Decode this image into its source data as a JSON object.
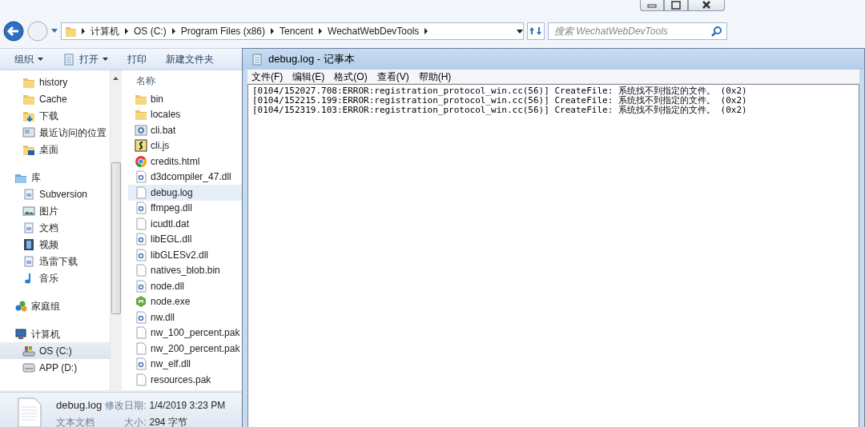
{
  "explorer": {
    "window_controls": [
      {
        "kind": "minimize"
      },
      {
        "kind": "maximize"
      },
      {
        "kind": "close"
      }
    ],
    "breadcrumb": [
      "计算机",
      "OS (C:)",
      "Program Files (x86)",
      "Tencent",
      "WechatWebDevTools"
    ],
    "search": {
      "placeholder": "搜索 WechatWebDevTools"
    },
    "toolbar": [
      {
        "label": "组织",
        "dropdown": true,
        "kind": "plain"
      },
      {
        "label": "打开",
        "dropdown": true,
        "kind": "notepad"
      },
      {
        "label": "打印",
        "dropdown": false,
        "kind": "plain"
      },
      {
        "label": "新建文件夹",
        "dropdown": false,
        "kind": "plain"
      }
    ],
    "nav_groups": [
      {
        "items": [
          {
            "label": "history",
            "kind": "folder",
            "selected": false
          },
          {
            "label": "Cache",
            "kind": "folder",
            "selected": false
          },
          {
            "label": "下载",
            "kind": "download",
            "selected": false
          },
          {
            "label": "最近访问的位置",
            "kind": "recent",
            "selected": false
          },
          {
            "label": "桌面",
            "kind": "desktop",
            "selected": false
          }
        ]
      },
      {
        "label": "库",
        "kind": "library",
        "items": [
          {
            "label": "Subversion",
            "kind": "doc",
            "selected": false
          },
          {
            "label": "图片",
            "kind": "picture",
            "selected": false
          },
          {
            "label": "文档",
            "kind": "doc",
            "selected": false
          },
          {
            "label": "视频",
            "kind": "video",
            "selected": false
          },
          {
            "label": "迅雷下载",
            "kind": "doc",
            "selected": false
          },
          {
            "label": "音乐",
            "kind": "music",
            "selected": false
          }
        ]
      },
      {
        "label": "家庭组",
        "kind": "homegroup"
      },
      {
        "label": "计算机",
        "kind": "computer",
        "items": [
          {
            "label": "OS (C:)",
            "kind": "osdrive",
            "selected": true
          },
          {
            "label": "APP (D:)",
            "kind": "drive",
            "selected": false
          }
        ]
      }
    ],
    "column_header": "名称",
    "files": [
      {
        "name": "bin",
        "kind": "folder",
        "selected": false
      },
      {
        "name": "locales",
        "kind": "folder",
        "selected": false
      },
      {
        "name": "cli.bat",
        "kind": "bat",
        "selected": false
      },
      {
        "name": "cli.js",
        "kind": "js",
        "selected": false
      },
      {
        "name": "credits.html",
        "kind": "chrome",
        "selected": false
      },
      {
        "name": "d3dcompiler_47.dll",
        "kind": "dll",
        "selected": false
      },
      {
        "name": "debug.log",
        "kind": "file",
        "selected": true
      },
      {
        "name": "ffmpeg.dll",
        "kind": "dll",
        "selected": false
      },
      {
        "name": "icudtl.dat",
        "kind": "file",
        "selected": false
      },
      {
        "name": "libEGL.dll",
        "kind": "dll",
        "selected": false
      },
      {
        "name": "libGLESv2.dll",
        "kind": "dll",
        "selected": false
      },
      {
        "name": "natives_blob.bin",
        "kind": "file",
        "selected": false
      },
      {
        "name": "node.dll",
        "kind": "dll",
        "selected": false
      },
      {
        "name": "node.exe",
        "kind": "node",
        "selected": false
      },
      {
        "name": "nw.dll",
        "kind": "dll",
        "selected": false
      },
      {
        "name": "nw_100_percent.pak",
        "kind": "file",
        "selected": false
      },
      {
        "name": "nw_200_percent.pak",
        "kind": "file",
        "selected": false
      },
      {
        "name": "nw_elf.dll",
        "kind": "dll",
        "selected": false
      },
      {
        "name": "resources.pak",
        "kind": "file",
        "selected": false
      }
    ],
    "status": {
      "name": "debug.log",
      "type": "文本文档",
      "modified_label": "修改日期:",
      "modified": "1/4/2019 3:23 PM",
      "size_label": "大小:",
      "size": "294 字节"
    }
  },
  "notepad": {
    "title": "debug.log - 记事本",
    "menus": [
      "文件(F)",
      "编辑(E)",
      "格式(O)",
      "查看(V)",
      "帮助(H)"
    ],
    "lines": [
      "[0104/152027.708:ERROR:registration_protocol_win.cc(56)] CreateFile: 系统找不到指定的文件。 (0x2)",
      "[0104/152215.199:ERROR:registration_protocol_win.cc(56)] CreateFile: 系统找不到指定的文件。 (0x2)",
      "[0104/152319.103:ERROR:registration_protocol_win.cc(56)] CreateFile: 系统找不到指定的文件。 (0x2)"
    ]
  }
}
